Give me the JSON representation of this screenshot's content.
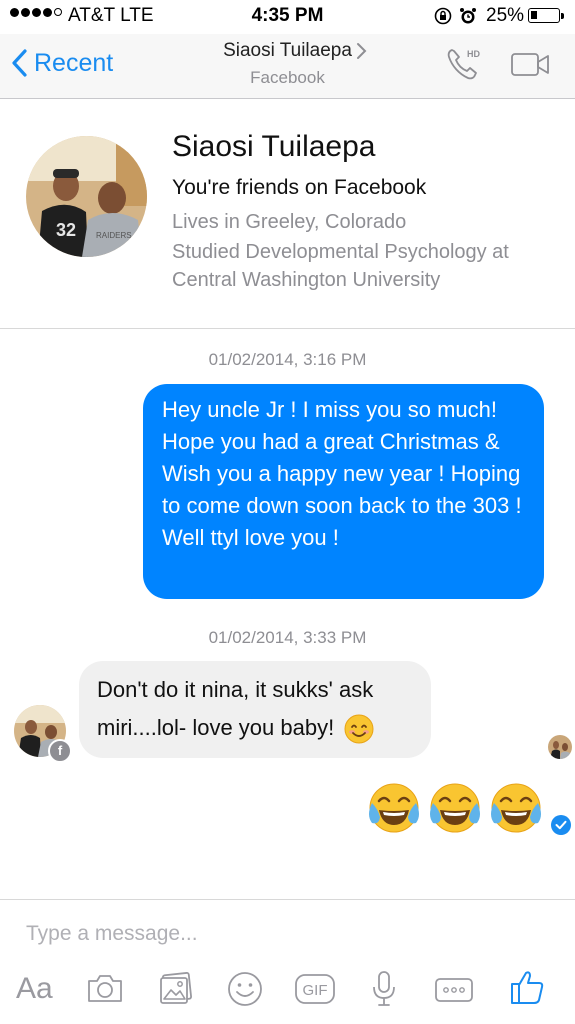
{
  "status_bar": {
    "carrier": "AT&T  LTE",
    "time": "4:35 PM",
    "battery": "25%",
    "battery_level": 0.25
  },
  "nav": {
    "back_label": "Recent",
    "title": "Siaosi Tuilaepa",
    "subtitle": "Facebook",
    "call_icon_badge": "HD"
  },
  "profile": {
    "name": "Siaosi Tuilaepa",
    "friends": "You're friends on Facebook",
    "lives": "Lives in Greeley, Colorado",
    "studied": "Studied Developmental Psychology at Central Washington University"
  },
  "messages": [
    {
      "timestamp": "01/02/2014, 3:16 PM",
      "direction": "sent",
      "text": "Hey uncle Jr ! I miss you so much! Hope you had a great Christmas & Wish you a happy new year ! Hoping to come down soon back to the 303 ! Well ttyl love you !"
    },
    {
      "timestamp": "01/02/2014, 3:33 PM",
      "direction": "received",
      "text": "Don't do it nina, it sukks' ask miri....lol- love you baby!"
    },
    {
      "direction": "sent",
      "emoji": [
        "face-with-tears-of-joy",
        "face-with-tears-of-joy",
        "face-with-tears-of-joy"
      ]
    }
  ],
  "composer": {
    "placeholder": "Type a message...",
    "aa_label": "Aa",
    "gif_label": "GIF"
  },
  "colors": {
    "accent": "#1a8cf0",
    "sent_bubble": "#0084ff",
    "received_bubble": "#f0f0f0",
    "secondary_text": "#8e8e93"
  }
}
